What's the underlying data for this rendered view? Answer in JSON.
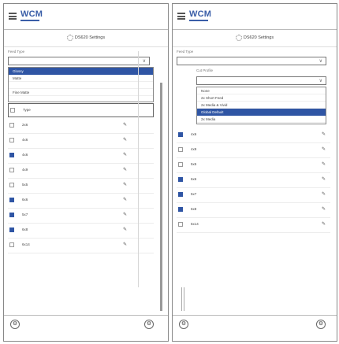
{
  "app": {
    "logo": "WCM"
  },
  "screen_title": "DS620 Settings",
  "left": {
    "field1_label": "Feed Type",
    "field1_value": "",
    "dropdown_items": [
      "Glossy",
      "Matte",
      "",
      "Fine Matte"
    ],
    "list_header": "Type",
    "rows": [
      {
        "code": "2x6",
        "checked": false
      },
      {
        "code": "4x6",
        "checked": false
      },
      {
        "code": "4x6",
        "checked": true
      },
      {
        "code": "4x9",
        "checked": false
      },
      {
        "code": "5x5",
        "checked": false
      },
      {
        "code": "6x6",
        "checked": true
      },
      {
        "code": "5x7",
        "checked": true
      },
      {
        "code": "6x8",
        "checked": true
      },
      {
        "code": "6x14",
        "checked": false
      }
    ]
  },
  "right": {
    "field1_label": "Feed Type",
    "field1_value": "",
    "field2_label": "Cut Profile",
    "field2_value": "",
    "dropdown_items": [
      "None",
      "2x Short Feed",
      "2x Media & Vivid",
      "Global Default",
      "2x Media"
    ],
    "dropdown_active_index": 3,
    "rows": [
      {
        "code": "4x6",
        "checked": true
      },
      {
        "code": "4x9",
        "checked": false
      },
      {
        "code": "5x5",
        "checked": false
      },
      {
        "code": "6x6",
        "checked": true
      },
      {
        "code": "5x7",
        "checked": true
      },
      {
        "code": "6x8",
        "checked": true
      },
      {
        "code": "6x14",
        "checked": false
      }
    ]
  },
  "edit_icon": "pencil-icon",
  "settings_icon": "gear-icon",
  "fab_icon": "tools-icon",
  "colors": {
    "accent": "#2f55a4",
    "logo": "#3a5ea8"
  }
}
